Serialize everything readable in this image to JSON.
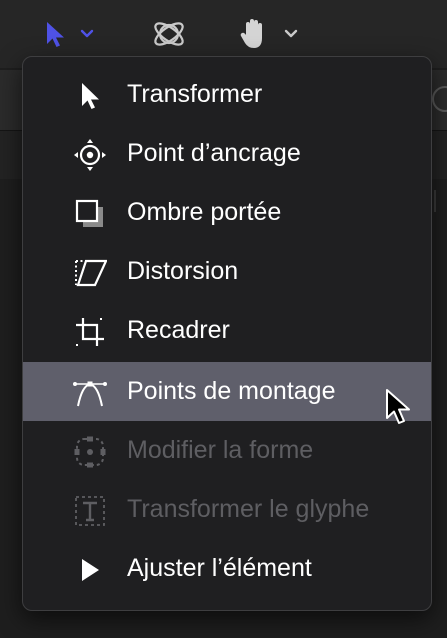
{
  "toolbar": {
    "select_tool_icon": "arrow-pointer-icon",
    "select_dropdown_icon": "chevron-down-icon",
    "orbit_tool_icon": "orbit-icon",
    "pan_tool_icon": "hand-icon",
    "pan_dropdown_icon": "chevron-down-icon"
  },
  "menu": {
    "items": [
      {
        "label": "Transformer",
        "icon": "arrow-pointer-icon",
        "state": "enabled"
      },
      {
        "label": "Point d’ancrage",
        "icon": "anchor-point-icon",
        "state": "enabled"
      },
      {
        "label": "Ombre portée",
        "icon": "drop-shadow-icon",
        "state": "enabled"
      },
      {
        "label": "Distorsion",
        "icon": "distort-icon",
        "state": "enabled"
      },
      {
        "label": "Recadrer",
        "icon": "crop-icon",
        "state": "enabled"
      },
      {
        "label": "Points de montage",
        "icon": "edit-points-icon",
        "state": "highlighted"
      },
      {
        "label": "Modifier la forme",
        "icon": "edit-shape-icon",
        "state": "disabled"
      },
      {
        "label": "Transformer le glyphe",
        "icon": "transform-glyph-icon",
        "state": "disabled"
      },
      {
        "label": "Ajuster l’élément",
        "icon": "adjust-item-icon",
        "state": "enabled"
      }
    ]
  },
  "colors": {
    "accent": "#4f52e6",
    "highlight": "#5f5f6b",
    "menu_bg": "#1f1f21",
    "disabled_text": "#5e5e62"
  }
}
